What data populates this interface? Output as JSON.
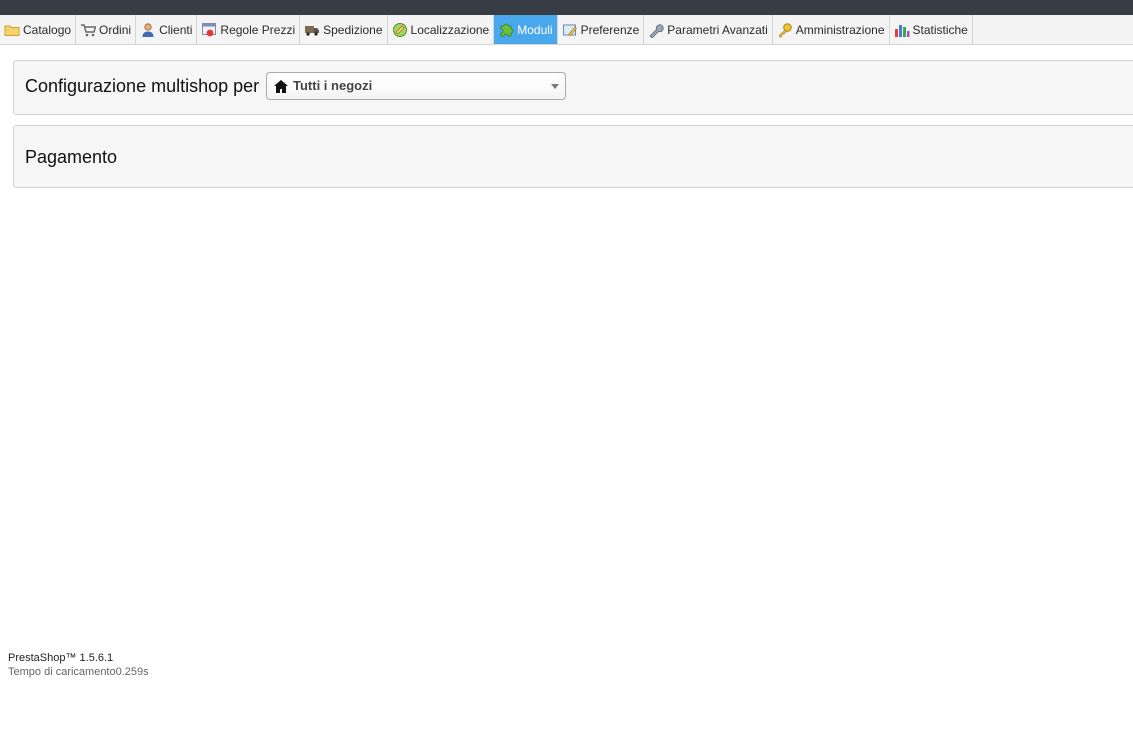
{
  "menu": {
    "active_color": "#49a7ec",
    "items": [
      {
        "label": "Catalogo",
        "icon": "folder-icon"
      },
      {
        "label": "Ordini",
        "icon": "cart-icon"
      },
      {
        "label": "Clienti",
        "icon": "user-icon"
      },
      {
        "label": "Regole Prezzi",
        "icon": "price-rules-icon"
      },
      {
        "label": "Spedizione",
        "icon": "truck-icon"
      },
      {
        "label": "Localizzazione",
        "icon": "globe-icon"
      },
      {
        "label": "Moduli",
        "icon": "puzzle-icon",
        "active": true
      },
      {
        "label": "Preferenze",
        "icon": "preferences-icon"
      },
      {
        "label": "Parametri Avanzati",
        "icon": "wrench-icon"
      },
      {
        "label": "Amministrazione",
        "icon": "key-icon"
      },
      {
        "label": "Statistiche",
        "icon": "chart-icon"
      }
    ]
  },
  "multishop": {
    "label": "Configurazione multishop per",
    "selected": "Tutti i negozi",
    "icon": "home-icon"
  },
  "payment": {
    "title": "Pagamento"
  },
  "footer": {
    "version": "PrestaShop™ 1.5.6.1",
    "load_time": "Tempo di caricamento0.259s"
  }
}
